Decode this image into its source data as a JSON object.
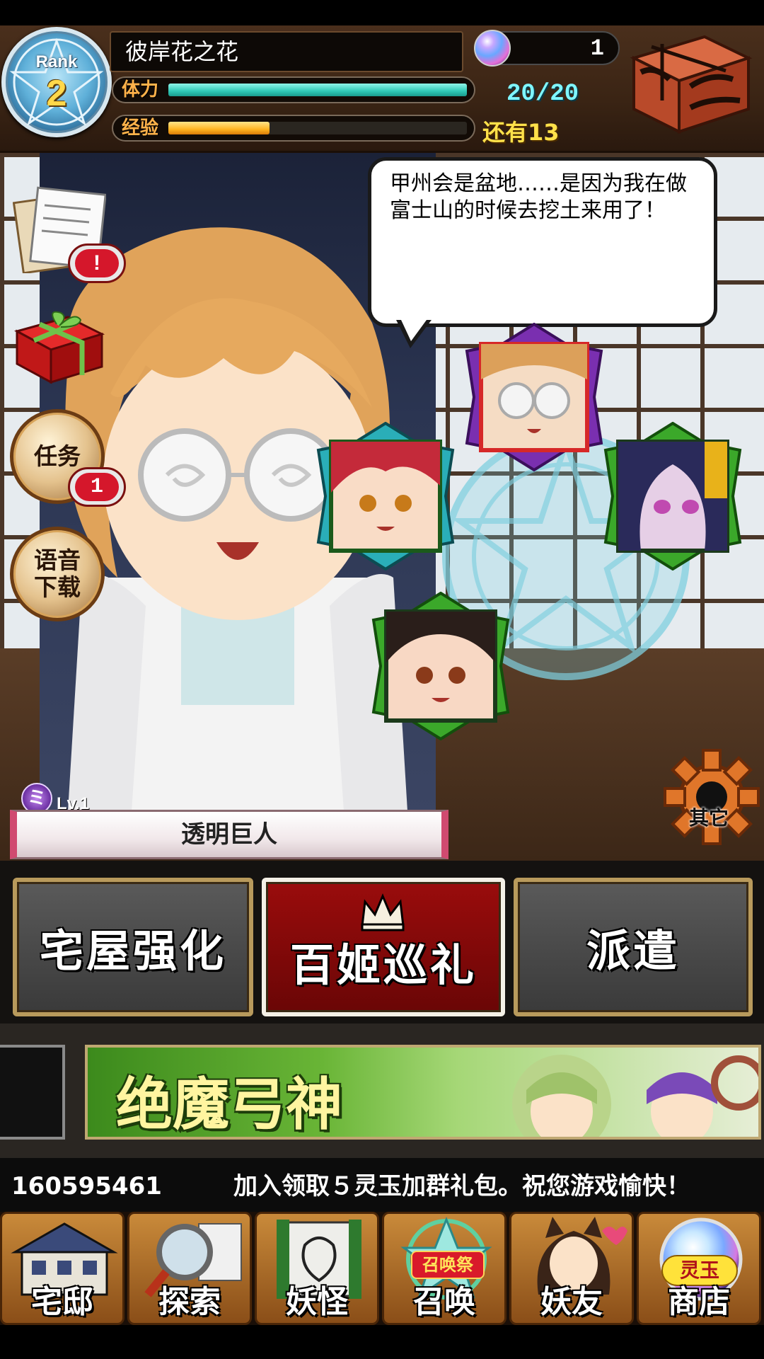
{
  "header": {
    "rank_label": "Rank",
    "rank_value": "2",
    "player_name": "彼岸花之花",
    "gem_count": "1",
    "stamina_label": "体力",
    "stamina_value": "20/20",
    "stamina_fraction": 1.0,
    "exp_label": "经验",
    "exp_fraction": 0.34,
    "exp_remaining": "还有13"
  },
  "scene": {
    "speech": "甲州会是盆地……是因为我在做富士山的时候去挖土来用了！",
    "side_buttons": {
      "notice_badge": "!",
      "task_label": "任务",
      "task_badge": "1",
      "voice_label": "语音\n下载"
    },
    "other_label": "其它",
    "character_level": "Lv.1",
    "character_level_icon": "ミ",
    "character_name": "透明巨人"
  },
  "actions": {
    "enhance": "宅屋强化",
    "parade": "百姬巡礼",
    "dispatch": "派遣"
  },
  "banner": {
    "title": "绝魔弓神"
  },
  "ticker": {
    "number": "160595461",
    "text": "加入领取５灵玉加群礼包。祝您游戏愉快！"
  },
  "nav": {
    "home": "宅邸",
    "explore": "探索",
    "youkai": "妖怪",
    "summon": "召唤",
    "summon_tag": "召唤祭",
    "friends": "妖友",
    "shop": "商店",
    "shop_tag": "灵玉"
  },
  "colors": {
    "stamina": "#2fc8b6",
    "exp": "#ffb31f",
    "parade_button": "#8a0a0a",
    "badge_red": "#d5172b"
  }
}
